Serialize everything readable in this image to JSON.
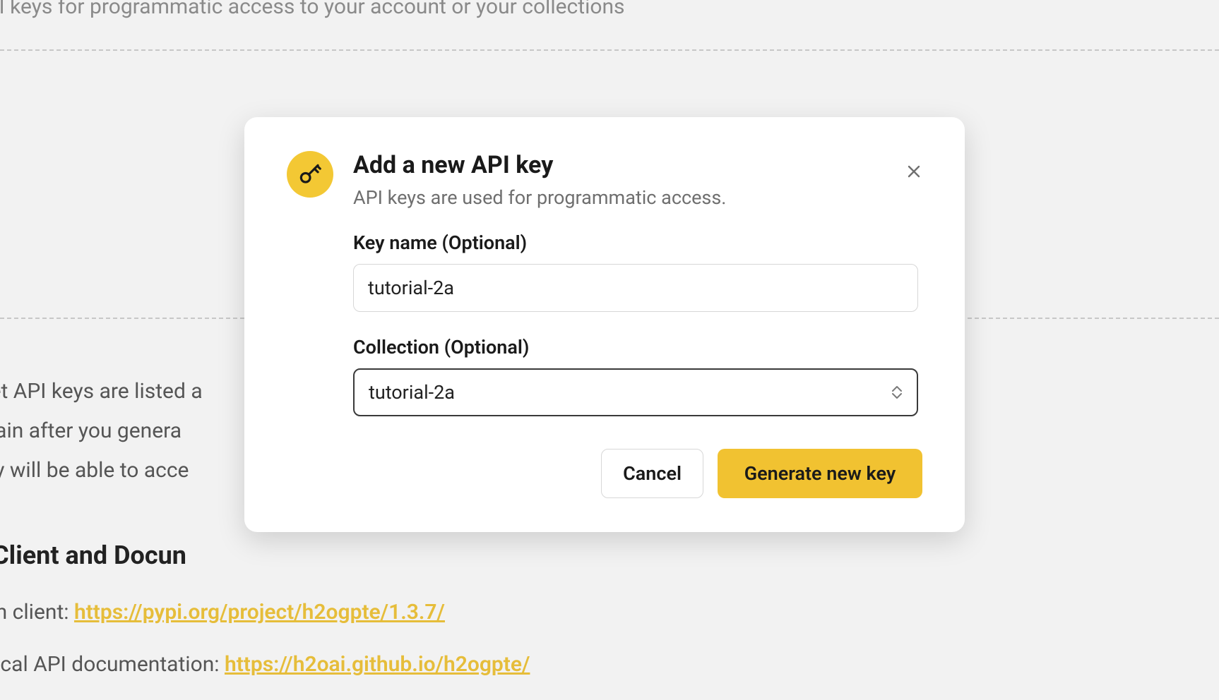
{
  "background": {
    "subtitle": "API keys for programmatic access to your account or your collections",
    "para_line1": "cret API keys are listed a",
    "para_line2": " again after you genera",
    "para_line3": "hey will be able to acce",
    "heading": "n Client and Docun",
    "client_label": "non client: ",
    "client_link": "https://pypi.org/project/h2ogpte/1.3.7/",
    "docs_label": "nnical API documentation: ",
    "docs_link": "https://h2oai.github.io/h2ogpte/"
  },
  "modal": {
    "title": "Add a new API key",
    "subtitle": "API keys are used for programmatic access.",
    "key_name_label": "Key name (Optional)",
    "key_name_value": "tutorial-2a",
    "collection_label": "Collection (Optional)",
    "collection_value": "tutorial-2a",
    "cancel_label": "Cancel",
    "generate_label": "Generate new key"
  }
}
